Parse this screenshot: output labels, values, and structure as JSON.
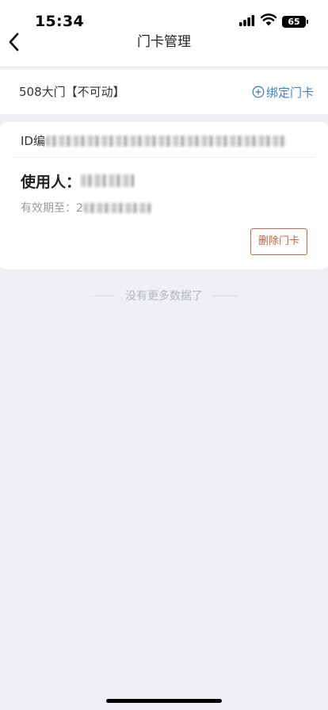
{
  "status": {
    "time": "15:34",
    "battery": "65"
  },
  "nav": {
    "title": "门卡管理"
  },
  "door": {
    "name": "508大门【不可动】",
    "bind_label": "绑定门卡"
  },
  "card": {
    "id_prefix": "ID编",
    "user_label": "使用人：",
    "valid_label": "有效期至：2",
    "delete_label": "删除门卡"
  },
  "list": {
    "no_more": "没有更多数据了"
  },
  "colors": {
    "link_blue": "#3c7fd6",
    "delete_orange": "#d0613d",
    "background": "#eef0f4"
  }
}
